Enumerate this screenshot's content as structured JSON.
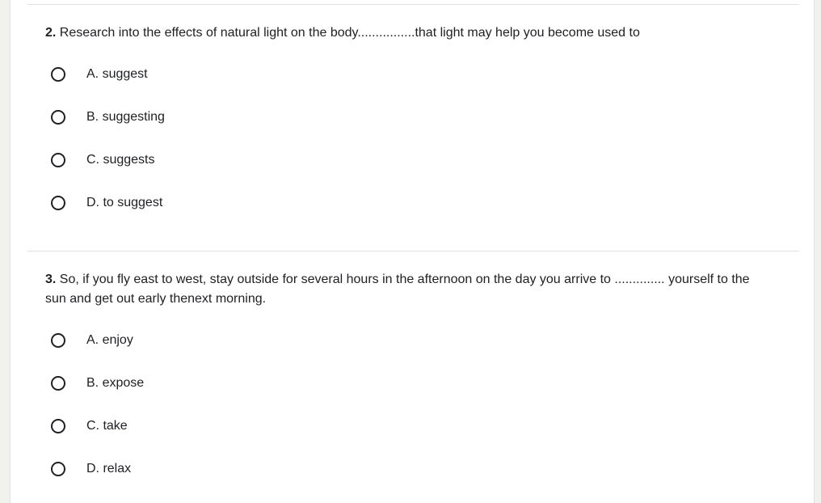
{
  "questions": [
    {
      "number": "2.",
      "text": "Research into the effects of natural light on the body................that light may help you become used to",
      "options": [
        {
          "label": "A. suggest",
          "selected": false
        },
        {
          "label": "B. suggesting",
          "selected": false
        },
        {
          "label": "C. suggests",
          "selected": false
        },
        {
          "label": "D. to suggest",
          "selected": false
        }
      ]
    },
    {
      "number": "3.",
      "text": "So, if you fly east to west, stay outside for several hours in the afternoon on the day you arrive to .............. yourself to the sun and get out early thenext morning.",
      "options": [
        {
          "label": "A. enjoy",
          "selected": false
        },
        {
          "label": "B. expose",
          "selected": false
        },
        {
          "label": "C. take",
          "selected": false
        },
        {
          "label": "D. relax",
          "selected": false
        }
      ]
    }
  ],
  "colors": {
    "text": "#202124",
    "divider": "#e0e0e0",
    "background": "#f1f1ee",
    "card": "#ffffff"
  },
  "icons": {
    "radio": "radio-unchecked-icon"
  }
}
